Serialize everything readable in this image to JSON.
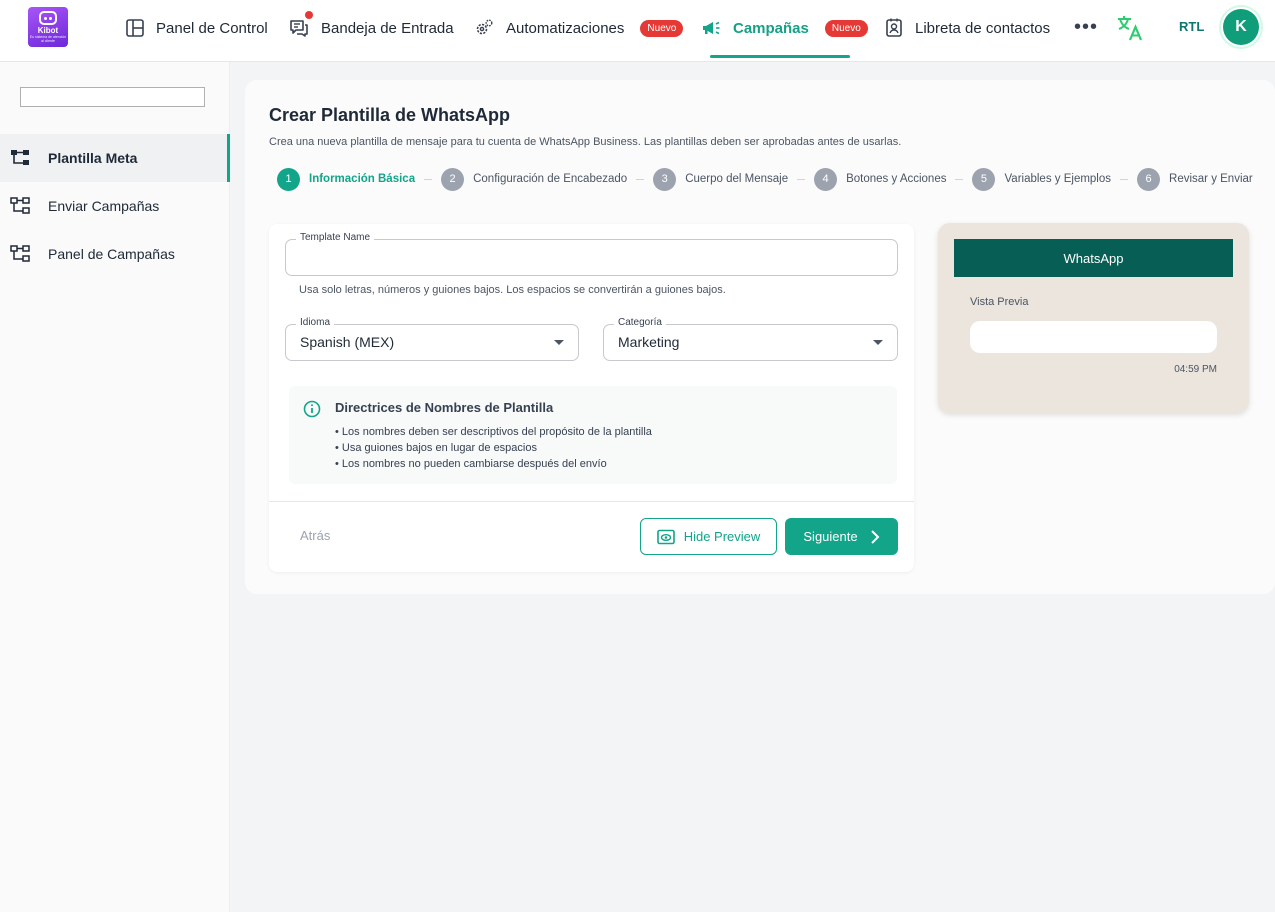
{
  "logo": {
    "name": "Kibot",
    "tagline": "Eu sistema de atención al cliente"
  },
  "nav": {
    "items": [
      {
        "label": "Panel de Control",
        "icon": "layout-icon"
      },
      {
        "label": "Bandeja de Entrada",
        "icon": "inbox-icon"
      },
      {
        "label": "Automatizaciones",
        "icon": "gears-icon",
        "badge": "Nuevo"
      },
      {
        "label": "Campañas",
        "icon": "megaphone-icon",
        "badge": "Nuevo",
        "active": true
      },
      {
        "label": "Libreta de contactos",
        "icon": "contacts-icon"
      }
    ],
    "more": "•••",
    "rtl": "RTL",
    "avatar_initial": "K"
  },
  "sidebar": {
    "items": [
      {
        "label": "Plantilla Meta",
        "active": true
      },
      {
        "label": "Enviar Campañas"
      },
      {
        "label": "Panel de Campañas"
      }
    ]
  },
  "page": {
    "title": "Crear Plantilla de WhatsApp",
    "subtitle": "Crea una nueva plantilla de mensaje para tu cuenta de WhatsApp Business. Las plantillas deben ser aprobadas antes de usarlas."
  },
  "steps": [
    {
      "num": "1",
      "label": "Información Básica",
      "active": true
    },
    {
      "num": "2",
      "label": "Configuración de Encabezado"
    },
    {
      "num": "3",
      "label": "Cuerpo del Mensaje"
    },
    {
      "num": "4",
      "label": "Botones y Acciones"
    },
    {
      "num": "5",
      "label": "Variables y Ejemplos"
    },
    {
      "num": "6",
      "label": "Revisar y Enviar"
    }
  ],
  "form": {
    "template_name": {
      "label": "Template Name",
      "value": ""
    },
    "helper": "Usa solo letras, números y guiones bajos. Los espacios se convertirán a guiones bajos.",
    "language": {
      "label": "Idioma",
      "value": "Spanish (MEX)"
    },
    "category": {
      "label": "Categoría",
      "value": "Marketing"
    }
  },
  "guidelines": {
    "title": "Directrices de Nombres de Plantilla",
    "items": [
      "• Los nombres deben ser descriptivos del propósito de la plantilla",
      "• Usa guiones bajos en lugar de espacios",
      "• Los nombres no pueden cambiarse después del envío"
    ]
  },
  "actions": {
    "back": "Atrás",
    "preview": "Hide Preview",
    "next": "Siguiente"
  },
  "preview": {
    "header": "WhatsApp",
    "label": "Vista Previa",
    "time": "04:59 PM"
  },
  "colors": {
    "accent": "#12a58a",
    "badge": "#e53935",
    "whatsapp_header": "#075e54",
    "whatsapp_bg": "#ece5dd"
  }
}
